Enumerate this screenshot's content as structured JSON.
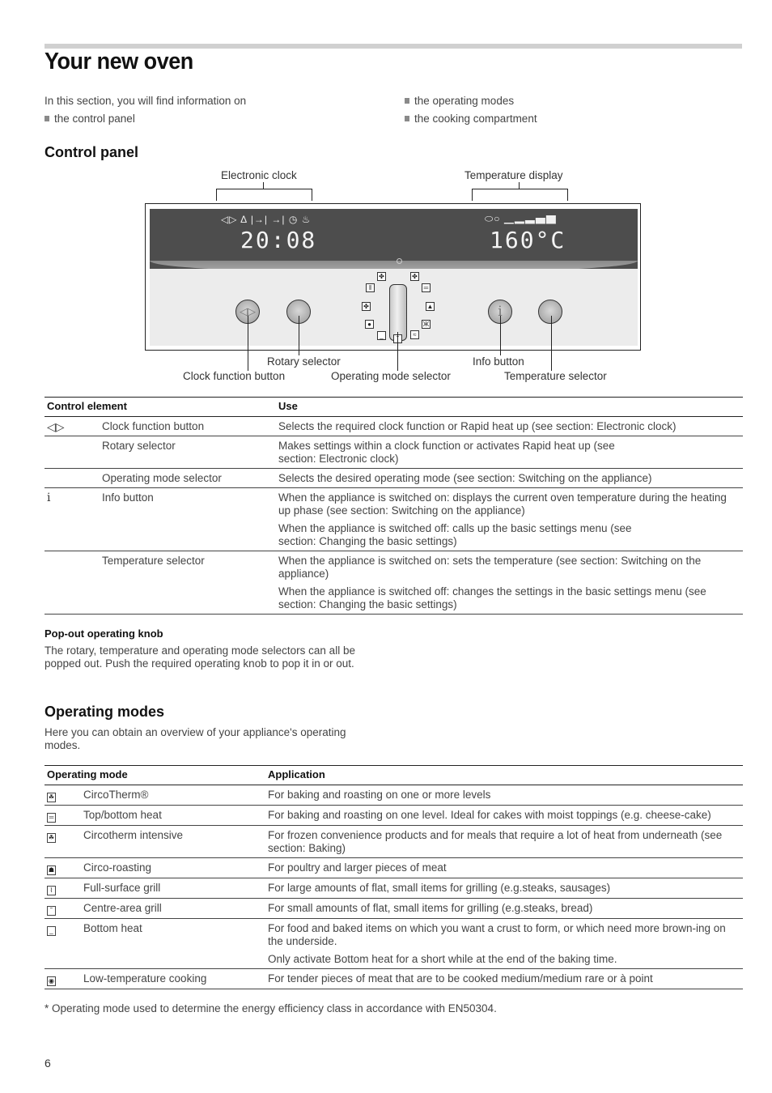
{
  "page": {
    "title": "Your new oven",
    "page_number": "6"
  },
  "intro": {
    "lead": "In this section, you will find information on",
    "bullets": [
      "the control panel",
      "the operating modes",
      "the cooking compartment"
    ]
  },
  "control_panel": {
    "heading": "Control panel",
    "diagram": {
      "labels": {
        "electronic_clock": "Electronic clock",
        "temperature_display": "Temperature display",
        "rotary_selector": "Rotary selector",
        "clock_function_button": "Clock function button",
        "operating_mode_selector": "Operating mode selector",
        "info_button": "Info button",
        "temperature_selector": "Temperature selector"
      },
      "clock_icons": "◁▷ Δ |→| →| ◷ ♨",
      "clock_time": "20:08",
      "temp_icons": "⬭○ ▁▂▃▅▇",
      "temperature": "160°C",
      "clock_button_symbol": "◁▷",
      "info_button_symbol": "i"
    },
    "table": {
      "headers": [
        "Control element",
        "Use"
      ],
      "rows": [
        {
          "symbol": "◁▷",
          "element": "Clock function button",
          "uses": [
            "Selects the required clock function or Rapid heat up (see section: Electronic clock)"
          ]
        },
        {
          "symbol": "",
          "element": "Rotary selector",
          "uses": [
            "Makes settings within a clock function or activates Rapid heat up (see section: Electronic clock)"
          ]
        },
        {
          "symbol": "",
          "element": "Operating mode selector",
          "uses": [
            "Selects the desired operating mode (see section: Switching on the appliance)"
          ]
        },
        {
          "symbol": "i",
          "element": "Info button",
          "uses": [
            "When the appliance is switched on: displays the current oven temperature during the heating up phase (see section: Switching on the appliance)",
            "When the appliance is switched off: calls up the basic settings menu (see section: Changing the basic settings)"
          ]
        },
        {
          "symbol": "",
          "element": "Temperature selector",
          "uses": [
            "When the appliance is switched on: sets the temperature (see section: Switching on the appliance)",
            "When the appliance is switched off: changes the settings in the basic settings menu (see section: Changing the basic settings)"
          ]
        }
      ]
    }
  },
  "popout": {
    "heading": "Pop-out operating knob",
    "text": "The rotary, temperature and operating mode selectors can all be popped out. Push the required operating knob to pop it in or out."
  },
  "operating_modes": {
    "heading": "Operating modes",
    "intro": "Here you can obtain an overview of your appliance's operating modes.",
    "table": {
      "headers": [
        "Operating mode",
        "Application"
      ],
      "rows": [
        {
          "icon": "circotherm-icon",
          "glyph": "☘",
          "mode": "CircoTherm®",
          "applications": [
            "For baking and roasting on one or more levels"
          ]
        },
        {
          "icon": "top-bottom-heat-icon",
          "glyph": "═",
          "mode": "Top/bottom heat",
          "applications": [
            "For baking and roasting on one level. Ideal for cakes with moist toppings (e.g. cheese-cake)"
          ]
        },
        {
          "icon": "circotherm-intensive-icon",
          "glyph": "☘",
          "mode": "Circotherm intensive",
          "applications": [
            "For frozen convenience products and for meals that require a lot of heat from underneath (see section: Baking)"
          ]
        },
        {
          "icon": "circo-roasting-icon",
          "glyph": "☗",
          "mode": "Circo-roasting",
          "applications": [
            "For poultry and larger pieces of meat"
          ]
        },
        {
          "icon": "full-surface-grill-icon",
          "glyph": "⌇",
          "mode": "Full-surface grill",
          "applications": [
            "For large amounts of flat, small items for grilling (e.g.steaks, sausages)"
          ]
        },
        {
          "icon": "centre-area-grill-icon",
          "glyph": "˜",
          "mode": "Centre-area grill",
          "applications": [
            "For small amounts of flat, small items for grilling (e.g.steaks, bread)"
          ]
        },
        {
          "icon": "bottom-heat-icon",
          "glyph": "_",
          "mode": "Bottom heat",
          "applications": [
            "For food and baked items on which you want a crust to form, or which need more brown-ing on the underside.",
            "Only activate Bottom heat for a short while at the end of the baking time."
          ]
        },
        {
          "icon": "low-temperature-icon",
          "glyph": "◉",
          "mode": "Low-temperature cooking",
          "applications": [
            "For tender pieces of meat that are to be cooked medium/medium rare or à point"
          ]
        }
      ]
    },
    "footnote": "* Operating mode used to determine the energy efficiency class in accordance with EN50304."
  }
}
